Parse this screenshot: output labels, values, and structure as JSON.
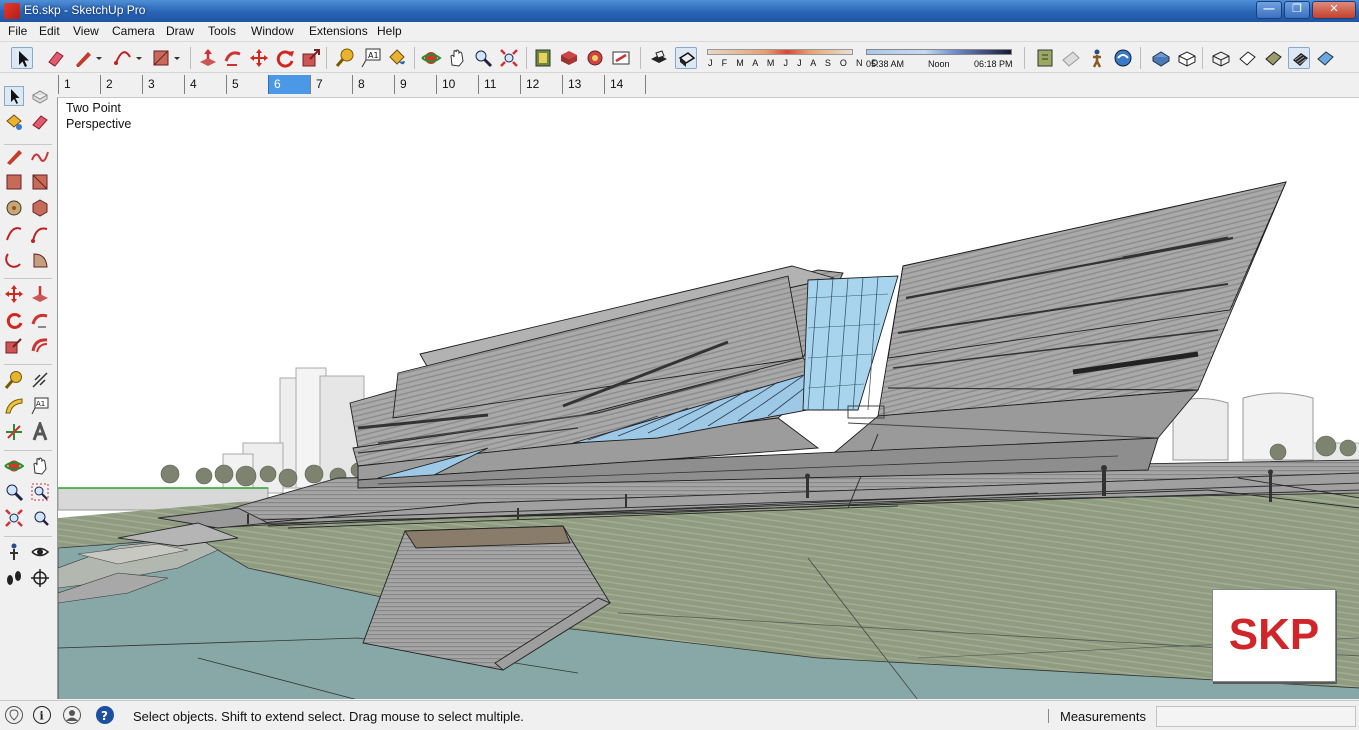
{
  "window": {
    "title": "E6.skp - SketchUp Pro",
    "min_glyph": "—",
    "max_glyph": "❐",
    "close_glyph": "✕"
  },
  "menu": [
    "File",
    "Edit",
    "View",
    "Camera",
    "Draw",
    "Tools",
    "Window",
    "Extensions",
    "Help"
  ],
  "shadow_settings": {
    "months_label": "J F M A M J J A S O N D",
    "time_start": "05:38 AM",
    "time_noon": "Noon",
    "time_end": "06:18 PM"
  },
  "scene_tabs": [
    "1",
    "2",
    "3",
    "4",
    "5",
    "6",
    "7",
    "8",
    "9",
    "10",
    "11",
    "12",
    "13",
    "14"
  ],
  "active_scene": "6",
  "viewport": {
    "camera_line1": "Two Point",
    "camera_line2": "Perspective"
  },
  "logo": {
    "text": "SKP",
    "color": "#d0262a"
  },
  "status": {
    "hint": "Select objects. Shift to extend select. Drag mouse to select multiple.",
    "measurements_label": "Measurements",
    "measurements_value": ""
  },
  "icons": {
    "toolbar": [
      "select-icon",
      "eraser-icon",
      "pencil-icon",
      "arc-icon",
      "rectangle-icon",
      "push-pull-icon",
      "follow-me-icon",
      "move-icon",
      "rotate-icon",
      "scale-icon",
      "tape-measure-icon",
      "text-icon",
      "paint-bucket-icon",
      "orbit-icon",
      "pan-icon",
      "zoom-icon",
      "zoom-extents-icon",
      "warehouse-icon",
      "extension-warehouse-icon",
      "components-icon",
      "send-to-layout-icon",
      "shadows-icon",
      "fog-icon",
      "section-icon",
      "styles-icon",
      "camera-icon",
      "walk-icon",
      "xray-icon",
      "back-edges-icon",
      "wireframe-icon",
      "hidden-line-icon",
      "shaded-icon",
      "textured-icon",
      "monochrome-icon"
    ]
  },
  "colors": {
    "accent_tab": "#4b98e6",
    "ground": "#8f9c80",
    "water": "#88a8a8",
    "building": "#a3a3a3",
    "glass": "#8fc6e6"
  }
}
